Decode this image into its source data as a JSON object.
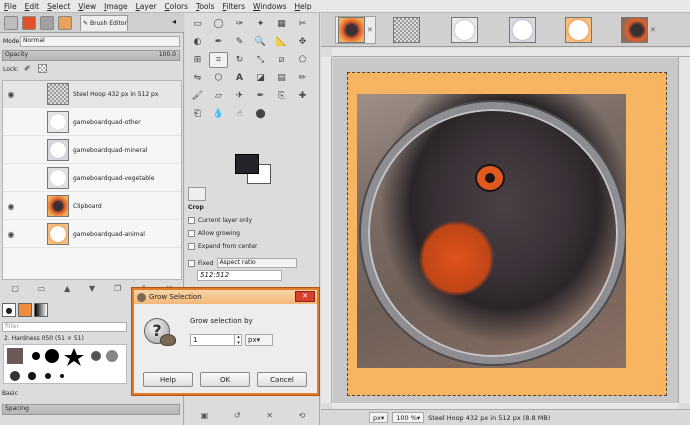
{
  "menubar": [
    "File",
    "Edit",
    "Select",
    "View",
    "Image",
    "Layer",
    "Colors",
    "Tools",
    "Filters",
    "Windows",
    "Help"
  ],
  "left_dock": {
    "brush_tab_label": "Brush Editor",
    "mode_label": "Mode:",
    "mode_value": "Normal",
    "opacity_label": "Opacity",
    "opacity_value": "100.0",
    "lock_label": "Lock:",
    "layers": [
      {
        "name": "Steel Hoop 432 px in 512 px",
        "visible": true
      },
      {
        "name": "gameboardquad-other",
        "visible": false
      },
      {
        "name": "gameboardquad-mineral",
        "visible": false
      },
      {
        "name": "gameboardquad-vegetable",
        "visible": false
      },
      {
        "name": "Clipboard",
        "visible": true
      },
      {
        "name": "gameboardquad-animal",
        "visible": true
      }
    ],
    "filter_placeholder": "filter",
    "brush_label": "2. Hardness 050 (51 × 51)",
    "basic_label": "Basic",
    "spacing_label": "Spacing"
  },
  "toolbox": {
    "crop_title": "Crop",
    "options": [
      {
        "label": "Current layer only",
        "checked": false
      },
      {
        "label": "Allow growing",
        "checked": false
      },
      {
        "label": "Expand from center",
        "checked": false
      }
    ],
    "fixed_label": "Fixed",
    "aspect_value": "Aspect ratio",
    "ratio_value": "512:512",
    "fg_color": "#27232a",
    "bg_color": "#ffffff"
  },
  "image_window": {
    "zoom_unit": "px",
    "zoom_value": "100 %",
    "status_text": "Steel Hoop 432 px in 512 px (8.8 MB)"
  },
  "dialog": {
    "title": "Grow Selection",
    "label": "Grow selection by",
    "value": "1",
    "unit": "px",
    "help_label": "Help",
    "ok_label": "OK",
    "cancel_label": "Cancel"
  }
}
